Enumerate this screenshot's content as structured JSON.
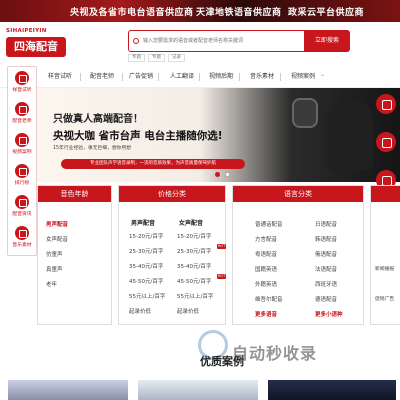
{
  "topbar": {
    "segments": [
      "央视及各省市电台语音供应商",
      "天津地铁语音供应商",
      "政采云平台供应商"
    ]
  },
  "logo": {
    "en": "SIHAIPEIYIN",
    "cn": "四海配音"
  },
  "search": {
    "placeholder": "输入您要需求的语音或者配音老师名称关键词",
    "button_label": "立即搜索",
    "hot_tags": [
      "专题",
      "专题",
      "记录"
    ]
  },
  "nav": {
    "items": [
      "样音试听",
      "配音老师",
      "广告促销",
      "人工翻译",
      "视频后期",
      "音乐素材",
      "视频案例"
    ]
  },
  "sidebar": {
    "items": [
      "样音试听",
      "配音老师",
      "视频案例",
      "排行榜",
      "配音资讯",
      "音乐素材"
    ]
  },
  "banner": {
    "line1": "只做真人高端配音！",
    "line2": "央视大咖 省市台声 电台主播随你选!",
    "line3": "15年行业经验，事无巨细，想你所想",
    "pill": "专业团队声学语音录制，一流的音质效果，为声音质量保驾护航"
  },
  "rightbar": {
    "items": [
      "",
      "",
      "",
      ""
    ]
  },
  "panels": {
    "age": {
      "title": "音色年龄",
      "items": [
        "男声配音",
        "女声配音",
        "仿童声",
        "真童声",
        "老年"
      ]
    },
    "price": {
      "title": "价格分类",
      "col1": {
        "head": "男声配音",
        "items": [
          "15-20元/百字",
          "25-30元/百字",
          "35-40元/百字",
          "45-50元/百字",
          "55元以上/百字",
          "起录价低"
        ]
      },
      "col2": {
        "head": "女声配音",
        "items": [
          "15-20元/百字",
          "25-30元/百字",
          "35-40元/百字",
          "45-50元/百字",
          "55元以上/百字",
          "起录价低"
        ]
      },
      "hot_label": "HOT"
    },
    "lang": {
      "title": "语言分类",
      "col1": [
        "普通话配音",
        "方言配音",
        "粤语配音",
        "国籍英语",
        "外籍英语",
        "维吾尔配音",
        "更多语音"
      ],
      "col2": [
        "日语配音",
        "韩语配音",
        "俄语配音",
        "法语配音",
        "西班牙语",
        "德语配音",
        "更多小语种"
      ]
    },
    "news": {
      "items": [
        "新闻播报",
        "促销广告"
      ]
    }
  },
  "section": {
    "title": "优质案例"
  },
  "watermark": {
    "text": "自动秒收录"
  },
  "colors": {
    "brand": "#c8161d",
    "topbar": "#6b0f10"
  }
}
